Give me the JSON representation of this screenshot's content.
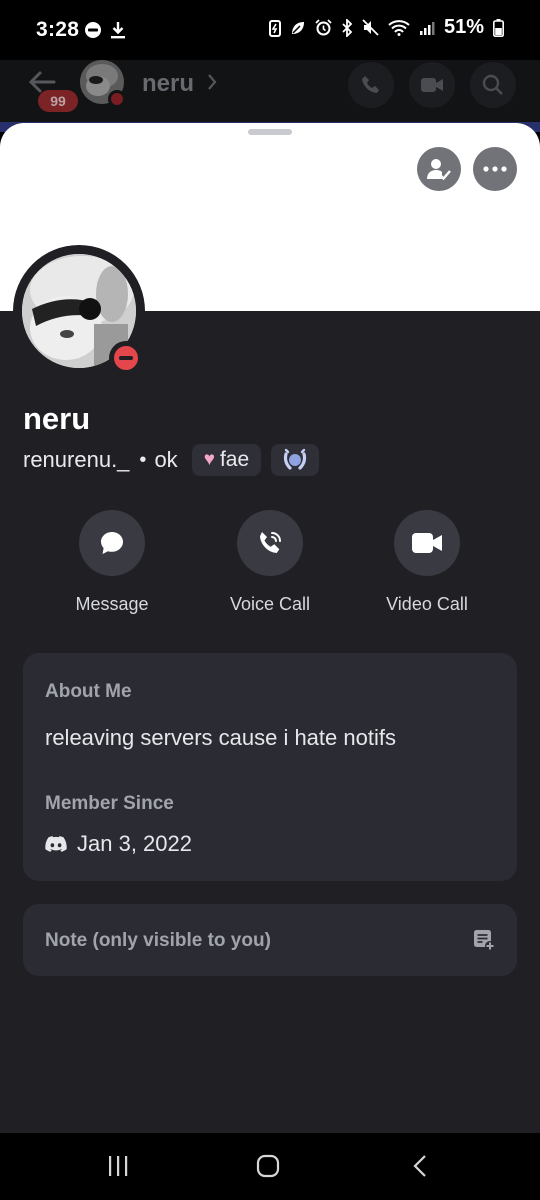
{
  "status_bar": {
    "time": "3:28",
    "battery": "51%",
    "left_icons": [
      "dnd-icon",
      "download-icon"
    ],
    "right_icons": [
      "battery-saver-icon",
      "leaf-icon",
      "alarm-icon",
      "bluetooth-icon",
      "mute-icon",
      "wifi-icon",
      "signal-icon",
      "battery-icon"
    ]
  },
  "header": {
    "unread_badge": "99",
    "channel_name": "neru"
  },
  "profile": {
    "display_name": "neru",
    "username": "renurenu._",
    "separator": "•",
    "custom_status": "ok",
    "tag_label": "fae",
    "tag_emoji": "♥",
    "presence": "do-not-disturb"
  },
  "actions": [
    {
      "label": "Message",
      "icon": "message-icon"
    },
    {
      "label": "Voice Call",
      "icon": "phone-icon"
    },
    {
      "label": "Video Call",
      "icon": "video-icon"
    }
  ],
  "about": {
    "heading": "About Me",
    "text": "releaving servers cause i hate notifs",
    "member_since_heading": "Member Since",
    "member_since_date": "Jan 3, 2022"
  },
  "note": {
    "placeholder": "Note (only visible to you)"
  },
  "colors": {
    "sheet_bg": "#1f1f24",
    "card_bg": "#2b2c33",
    "banner": "#ffffff",
    "dnd_red": "#e4474b",
    "accent_indigo": "#5865f2"
  }
}
